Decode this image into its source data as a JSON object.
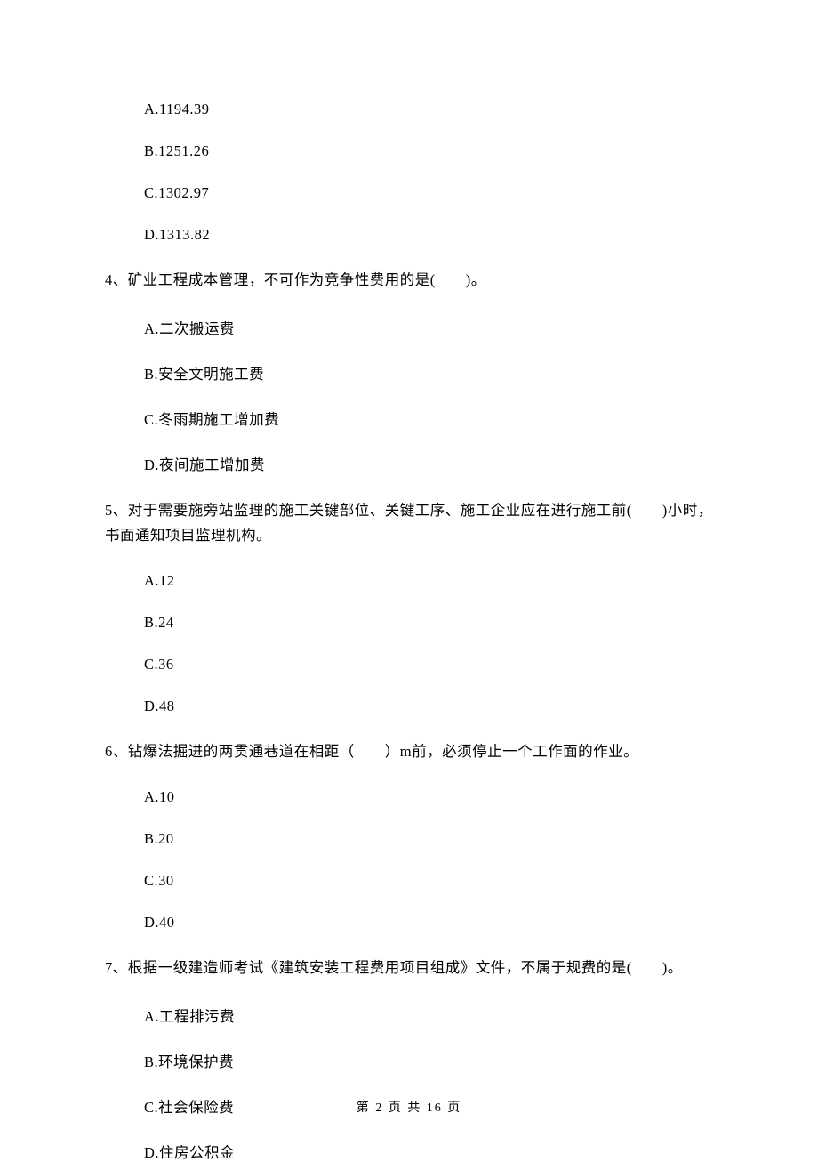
{
  "q3": {
    "A": "A.1194.39",
    "B": "B.1251.26",
    "C": "C.1302.97",
    "D": "D.1313.82"
  },
  "q4": {
    "text": "4、矿业工程成本管理，不可作为竞争性费用的是(　　)。",
    "A": "A.二次搬运费",
    "B": "B.安全文明施工费",
    "C": "C.冬雨期施工增加费",
    "D": "D.夜间施工增加费"
  },
  "q5": {
    "text": "5、对于需要施旁站监理的施工关键部位、关键工序、施工企业应在进行施工前(　　)小时，书面通知项目监理机构。",
    "A": "A.12",
    "B": "B.24",
    "C": "C.36",
    "D": "D.48"
  },
  "q6": {
    "text": "6、钻爆法掘进的两贯通巷道在相距（　　）m前，必须停止一个工作面的作业。",
    "A": "A.10",
    "B": "B.20",
    "C": "C.30",
    "D": "D.40"
  },
  "q7": {
    "text": "7、根据一级建造师考试《建筑安装工程费用项目组成》文件，不属于规费的是(　　)。",
    "A": "A.工程排污费",
    "B": "B.环境保护费",
    "C": "C.社会保险费",
    "D": "D.住房公积金"
  },
  "footer": "第 2 页 共 16 页"
}
